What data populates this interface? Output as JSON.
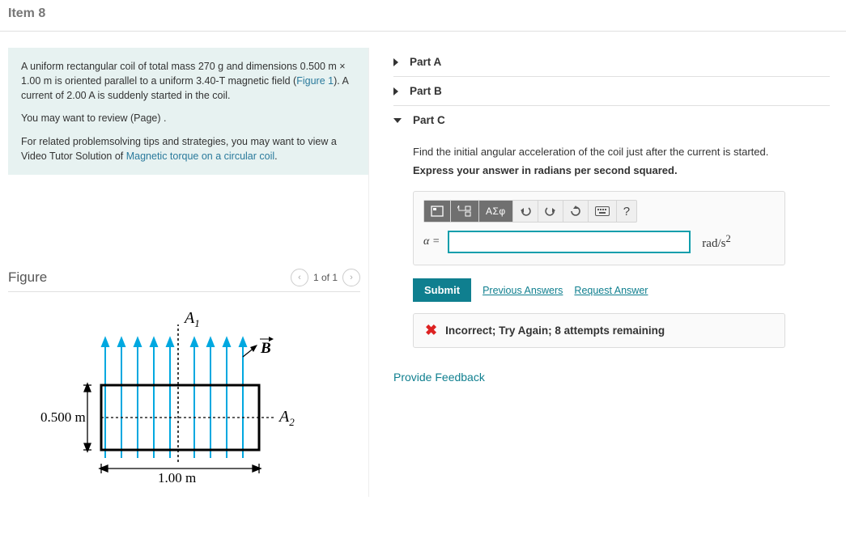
{
  "item_title": "Item 8",
  "problem": {
    "p1_a": "A uniform rectangular coil of total mass 270 g and dimensions 0.500 m × 1.00 m is oriented parallel to a uniform 3.40-T magnetic field (",
    "p1_link": "Figure 1",
    "p1_b": "). A current of 2.00 A is suddenly started in the coil.",
    "p2": "You may want to review (Page) .",
    "p3_a": "For related problemsolving tips and strategies, you may want to view a Video Tutor Solution of ",
    "p3_link": "Magnetic torque on a circular coil",
    "p3_b": "."
  },
  "figure": {
    "title": "Figure",
    "nav_label": "1 of 1",
    "labels": {
      "A1": "A",
      "A1_sub": "1",
      "A2": "A",
      "A2_sub": "2",
      "B": "B",
      "width": "1.00 m",
      "height": "0.500 m"
    }
  },
  "parts": {
    "a": {
      "label": "Part A"
    },
    "b": {
      "label": "Part B"
    },
    "c": {
      "label": "Part C",
      "prompt": "Find the initial angular acceleration of the coil just after the current is started.",
      "hint": "Express your answer in radians per second squared.",
      "var": "α =",
      "unit_html": "rad/s²",
      "toolbar": {
        "greek": "ΑΣφ",
        "help": "?"
      },
      "submit": "Submit",
      "prev_answers": "Previous Answers",
      "request_answer": "Request Answer",
      "feedback": "Incorrect; Try Again; 8 attempts remaining"
    }
  },
  "provide_feedback": "Provide Feedback"
}
